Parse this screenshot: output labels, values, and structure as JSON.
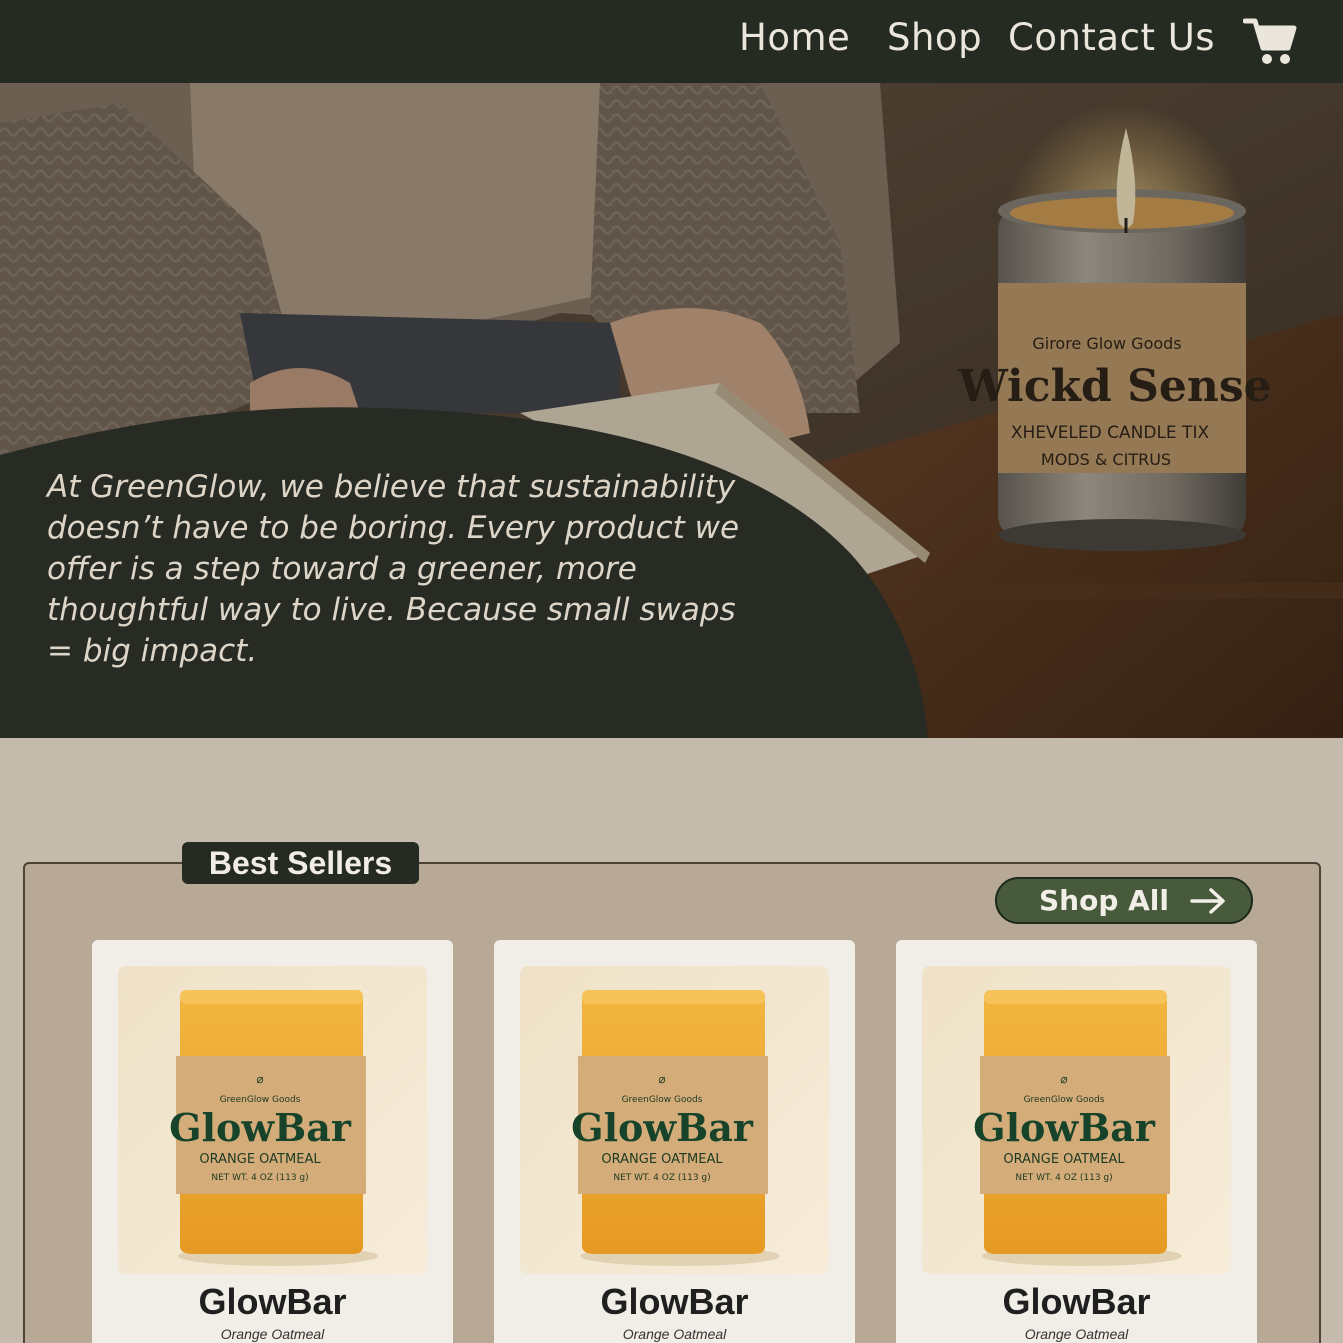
{
  "nav": {
    "links": [
      "Home",
      "Shop",
      "Contact Us"
    ],
    "cart_icon": "shopping-cart-icon"
  },
  "hero": {
    "text": "At GreenGlow, we believe that sustainability doesn’t have to be boring. Every product we offer is a step toward a greener, more thoughtful way to live. Because small swaps = big impact.",
    "candle_label": {
      "brand": "Girore Glow Goods",
      "name": "Wickd Sense",
      "line1": "XHEVELED CANDLE TIX",
      "line2": "MODS & CITRUS"
    }
  },
  "best_sellers": {
    "title": "Best Sellers",
    "shop_all_label": "Shop All",
    "shop_all_icon": "arrow-right-icon",
    "products": [
      {
        "name": "GlowBar",
        "variant": "Orange Oatmeal",
        "label": {
          "brand": "GreenGlow Goods",
          "name": "GlowBar",
          "scent": "ORANGE OATMEAL",
          "weight": "NET WT. 4 OZ (113 g)"
        }
      },
      {
        "name": "GlowBar",
        "variant": "Orange Oatmeal",
        "label": {
          "brand": "GreenGlow Goods",
          "name": "GlowBar",
          "scent": "ORANGE OATMEAL",
          "weight": "NET WT. 4 OZ (113 g)"
        }
      },
      {
        "name": "GlowBar",
        "variant": "Orange Oatmeal",
        "label": {
          "brand": "GreenGlow Goods",
          "name": "GlowBar",
          "scent": "ORANGE OATMEAL",
          "weight": "NET WT. 4 OZ (113 g)"
        }
      }
    ]
  },
  "colors": {
    "nav_bg": "#252a22",
    "page_bg": "#c5bbad",
    "panel_bg": "#b7a996",
    "button_green": "#485a3c",
    "card_bg": "#f1ede7"
  }
}
